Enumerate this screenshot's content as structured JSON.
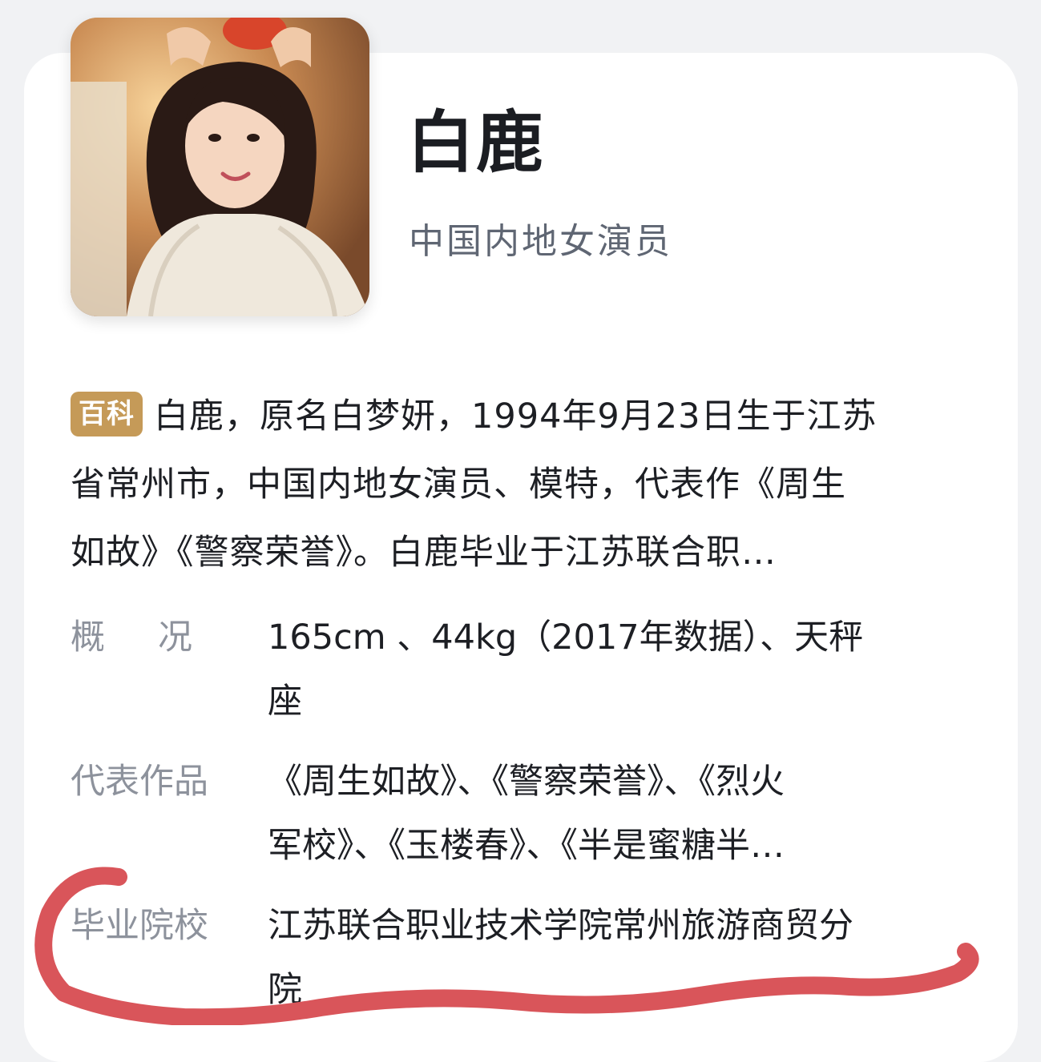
{
  "profile": {
    "name": "白鹿",
    "subtitle": "中国内地女演员",
    "badge": "百科",
    "summary_lines": [
      "白鹿，原名白梦妍，1994年9月23日生于江苏",
      "省常州市，中国内地女演员、模特，代表作《周生",
      "如故》《警察荣誉》。白鹿毕业于江苏联合职…"
    ]
  },
  "info": [
    {
      "label": "概况",
      "value_lines": [
        "165cm 、44kg（2017年数据）、天秤",
        "座"
      ]
    },
    {
      "label": "代表作品",
      "value_lines": [
        "《周生如故》、《警察荣誉》、《烈火",
        "军校》、《玉楼春》、《半是蜜糖半…"
      ]
    },
    {
      "label": "毕业院校",
      "value_lines": [
        "江苏联合职业技术学院常州旅游商贸分",
        "院"
      ]
    }
  ],
  "colors": {
    "badge": "#c59a58",
    "annotation": "#d9555a",
    "label": "#8d929c",
    "text": "#1d1f24"
  },
  "icons": {
    "portrait": "portrait-photo",
    "annotation": "red-underline-scribble"
  }
}
